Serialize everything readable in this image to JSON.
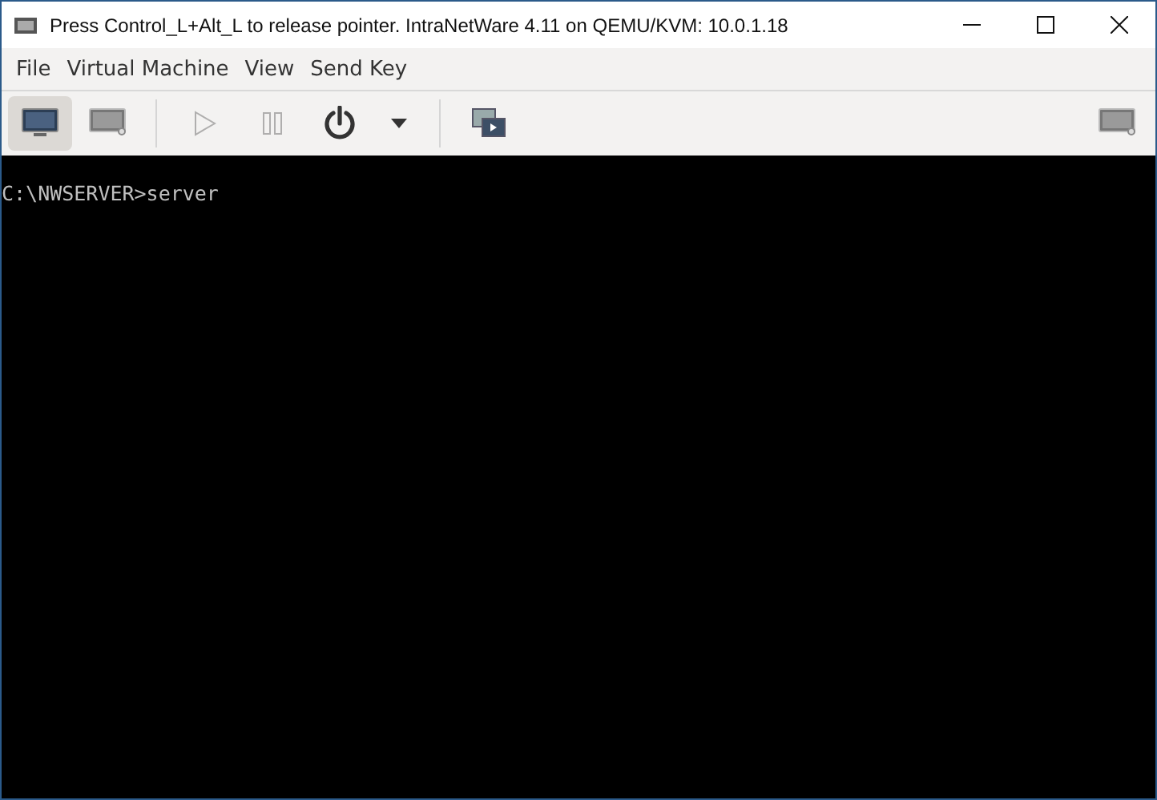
{
  "window": {
    "title": "Press Control_L+Alt_L to release pointer. IntraNetWare 4.11 on QEMU/KVM: 10.0.1.18"
  },
  "menu": [
    "File",
    "Virtual Machine",
    "View",
    "Send Key"
  ],
  "toolbar": [
    {
      "kind": "console",
      "selected": true,
      "disabled": false
    },
    {
      "kind": "details",
      "selected": false,
      "disabled": false
    },
    {
      "kind": "separator"
    },
    {
      "kind": "run",
      "selected": false,
      "disabled": true
    },
    {
      "kind": "pause",
      "selected": false,
      "disabled": true
    },
    {
      "kind": "power",
      "selected": false,
      "disabled": false
    },
    {
      "kind": "caret",
      "selected": false,
      "disabled": false
    },
    {
      "kind": "separator"
    },
    {
      "kind": "snapshots",
      "selected": false,
      "disabled": false
    },
    {
      "kind": "spacer"
    },
    {
      "kind": "fullscreen",
      "selected": false,
      "disabled": false
    }
  ],
  "console": {
    "lines": [
      "C:\\NWSERVER>server"
    ]
  }
}
